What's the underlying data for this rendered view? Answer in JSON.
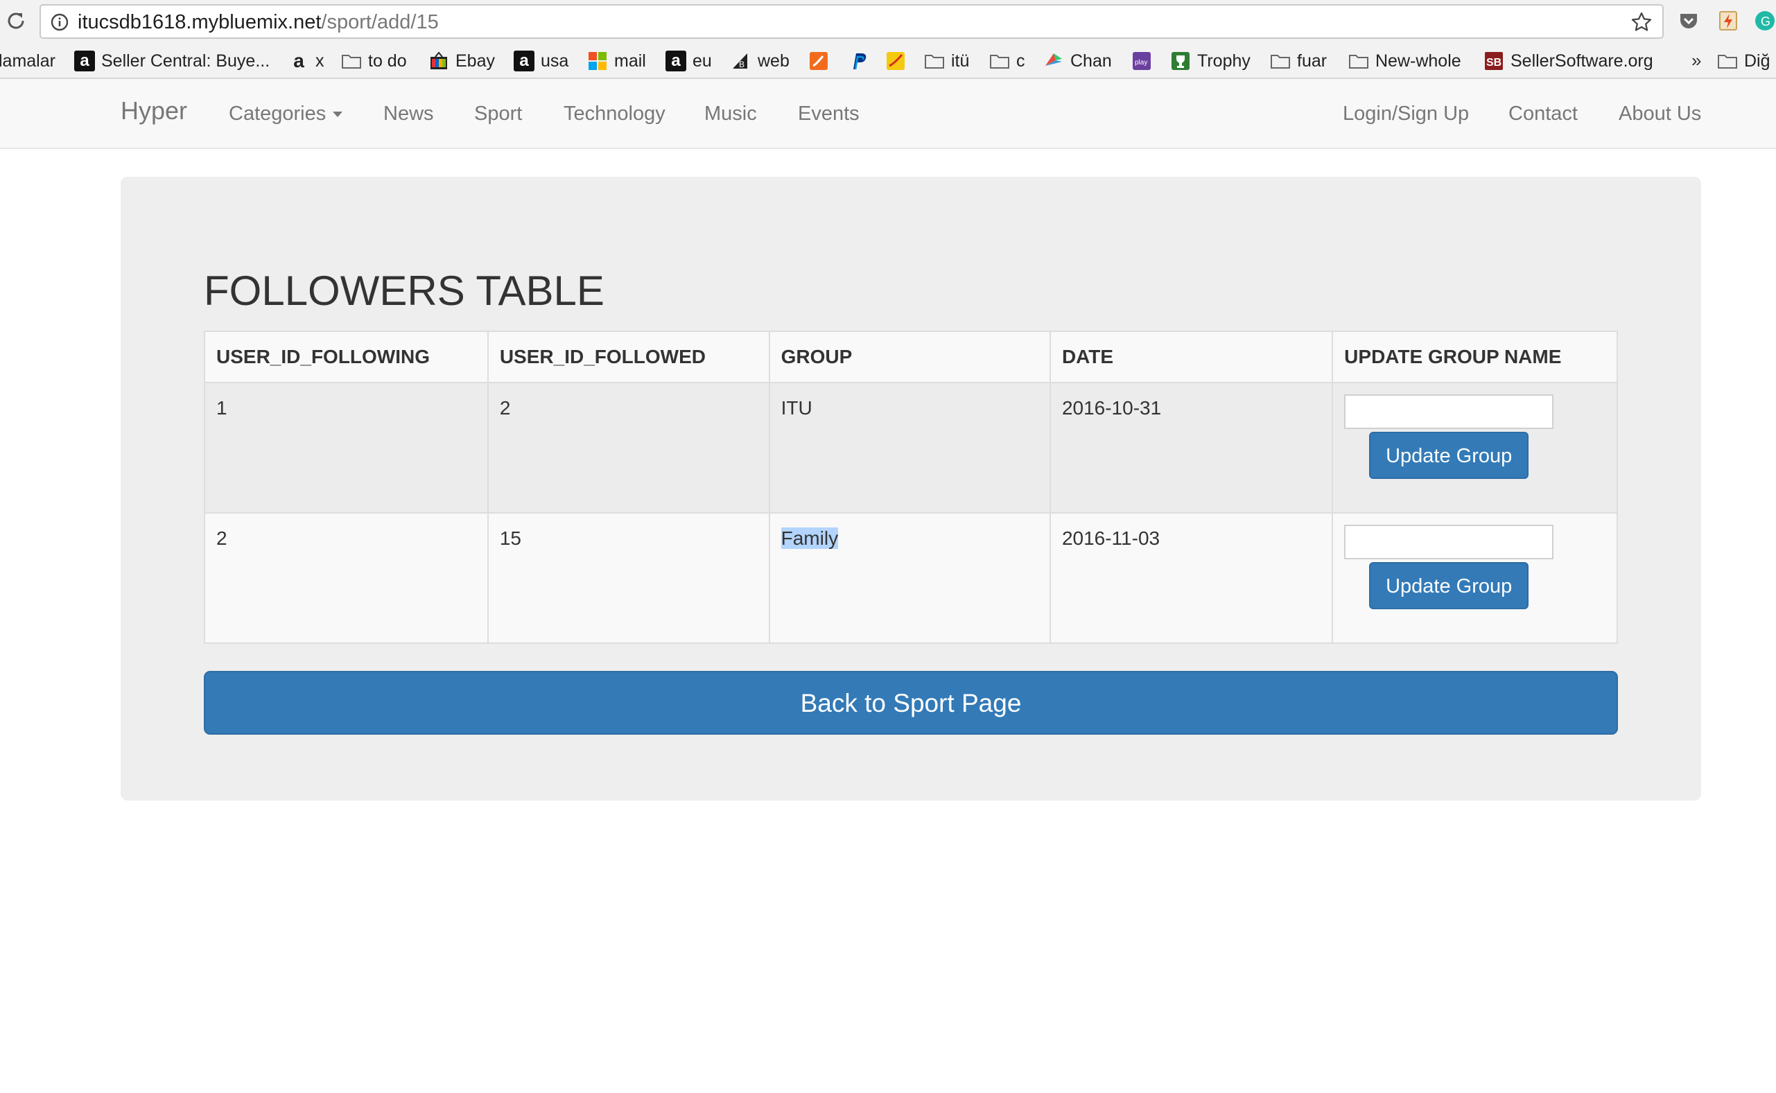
{
  "browser": {
    "url_host": "itucsdb1618.mybluemix.net",
    "url_path": "/sport/add/15",
    "bookmarks": [
      {
        "label": "lamalar",
        "icon": "none"
      },
      {
        "label": "Seller Central: Buye...",
        "icon": "amazon-icon"
      },
      {
        "label": "x",
        "icon": "amazon-smile-icon"
      },
      {
        "label": "to do",
        "icon": "folder-icon"
      },
      {
        "label": "Ebay",
        "icon": "ebay-icon"
      },
      {
        "label": "usa",
        "icon": "amazon-icon"
      },
      {
        "label": "mail",
        "icon": "microsoft-icon"
      },
      {
        "label": "eu",
        "icon": "amazon-icon"
      },
      {
        "label": "web",
        "icon": "web-icon"
      },
      {
        "label": "",
        "icon": "orange-app-icon"
      },
      {
        "label": "",
        "icon": "paypal-icon"
      },
      {
        "label": "",
        "icon": "yellow-app-icon"
      },
      {
        "label": "itü",
        "icon": "folder-icon"
      },
      {
        "label": "c",
        "icon": "folder-icon"
      },
      {
        "label": "Chan",
        "icon": "chan-icon"
      },
      {
        "label": "",
        "icon": "play-icon"
      },
      {
        "label": "Trophy",
        "icon": "trophy-app-icon"
      },
      {
        "label": "fuar",
        "icon": "folder-icon"
      },
      {
        "label": "New-whole",
        "icon": "folder-icon"
      },
      {
        "label": "SellerSoftware.org",
        "icon": "sb-icon"
      },
      {
        "label": "»",
        "icon": "none"
      },
      {
        "label": "Diğ",
        "icon": "folder-icon"
      }
    ]
  },
  "nav": {
    "brand": "Hyper",
    "categories": "Categories",
    "news": "News",
    "sport": "Sport",
    "technology": "Technology",
    "music": "Music",
    "events": "Events",
    "login": "Login/Sign Up",
    "contact": "Contact",
    "about": "About Us"
  },
  "main": {
    "title": "FOLLOWERS TABLE",
    "table": {
      "headers": [
        "USER_ID_FOLLOWING",
        "USER_ID_FOLLOWED",
        "GROUP",
        "DATE",
        "UPDATE GROUP NAME"
      ],
      "rows": [
        {
          "following": "1",
          "followed": "2",
          "group": "ITU",
          "date": "2016-10-31",
          "input_value": "",
          "button": "Update Group"
        },
        {
          "following": "2",
          "followed": "15",
          "group": "Family",
          "date": "2016-11-03",
          "input_value": "",
          "button": "Update Group"
        }
      ]
    },
    "back_button": "Back to Sport Page"
  },
  "colors": {
    "primary": "#337ab7",
    "jumbotron": "#eeeeee",
    "navbar": "#f8f8f8",
    "selection": "#b3d4fc"
  }
}
